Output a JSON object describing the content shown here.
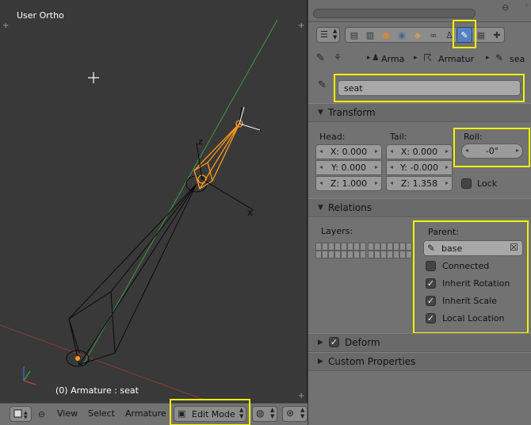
{
  "viewport": {
    "title": "User Ortho",
    "status": "(0) Armature : seat"
  },
  "bottom_header": {
    "menu_view": "View",
    "menu_select": "Select",
    "menu_armature": "Armature",
    "mode": "Edit Mode"
  },
  "properties": {
    "breadcrumb": {
      "item1": "Arma",
      "item2": "Armatur",
      "item3": "sea"
    },
    "bone_name": "seat",
    "transform": {
      "header": "Transform",
      "head_label": "Head:",
      "tail_label": "Tail:",
      "roll_label": "Roll:",
      "head_x": "X: 0.000",
      "head_y": "Y: 0.000",
      "head_z": "Z: 1.000",
      "tail_x": "X: 0.000",
      "tail_y": "Y: -0.000",
      "tail_z": "Z: 1.358",
      "roll_value": "-0°",
      "lock_label": "Lock",
      "lock_checked": false
    },
    "relations": {
      "header": "Relations",
      "layers_label": "Layers:",
      "parent_label": "Parent:",
      "parent_value": "base",
      "connected_label": "Connected",
      "connected_checked": false,
      "inherit_rotation_label": "Inherit Rotation",
      "inherit_rotation_checked": true,
      "inherit_scale_label": "Inherit Scale",
      "inherit_scale_checked": true,
      "local_location_label": "Local Location",
      "local_location_checked": true
    },
    "deform": {
      "header": "Deform",
      "checked": true
    },
    "custom_properties": {
      "header": "Custom Properties"
    }
  },
  "colors": {
    "highlight": "#f2f200",
    "selected_bone": "#ff9a1a",
    "grid_green": "#3f9a3f",
    "grid_red": "#9a3f3f"
  }
}
